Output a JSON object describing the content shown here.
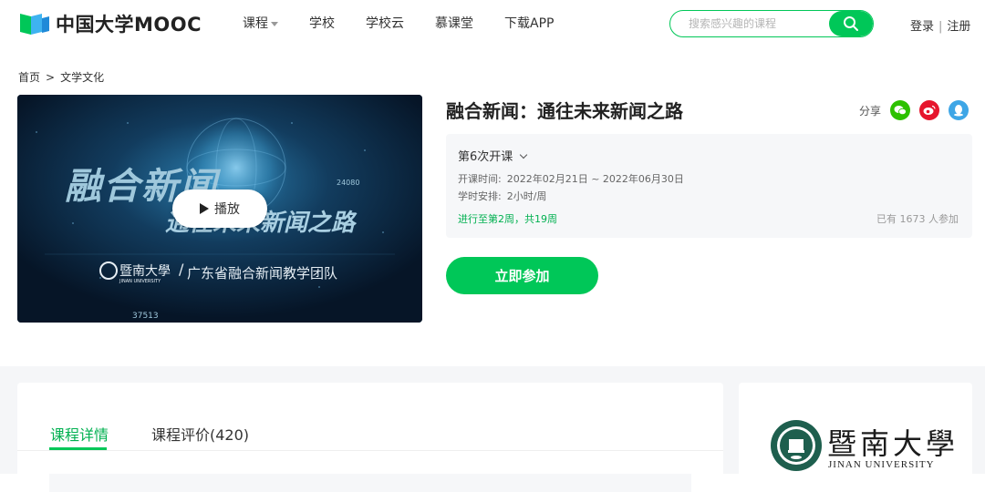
{
  "header": {
    "logo_text": "中国大学MOOC",
    "nav": [
      "课程",
      "学校",
      "学校云",
      "慕课堂",
      "下载APP"
    ],
    "search": {
      "placeholder": "搜索感兴趣的课程"
    },
    "auth": {
      "login": "登录",
      "sep": "|",
      "register": "注册"
    }
  },
  "breadcrumb": {
    "home": "首页",
    "sep": ">",
    "category": "文学文化"
  },
  "banner": {
    "title_line1": "融合新闻",
    "title_line2": "通往未来新闻之路",
    "team": "广东省融合新闻教学团队",
    "uni_short": "暨南大學",
    "uni_en_small": "JINAN UNIVERSITY",
    "numbers": [
      "24080",
      "37513"
    ],
    "play_label": "播放"
  },
  "course": {
    "title": "融合新闻：通往未来新闻之路",
    "share_label": "分享",
    "session": "第6次开课",
    "time_label": "开课时间:",
    "time_value": "2022年02月21日 ~ 2022年06月30日",
    "hours_label": "学时安排:",
    "hours_value": "2小时/周",
    "progress": "进行至第2周，共19周",
    "joined": "已有 1673 人参加",
    "join_button": "立即参加"
  },
  "tabs": {
    "detail": "课程详情",
    "reviews": "课程评价(420)"
  },
  "school": {
    "name_cn": "暨南大學",
    "name_en": "JINAN UNIVERSITY"
  },
  "colors": {
    "brand_green": "#00c758",
    "text_green": "#00b050",
    "wechat": "#2dc100",
    "weibo": "#e6162d",
    "qq": "#3ea6e6"
  }
}
